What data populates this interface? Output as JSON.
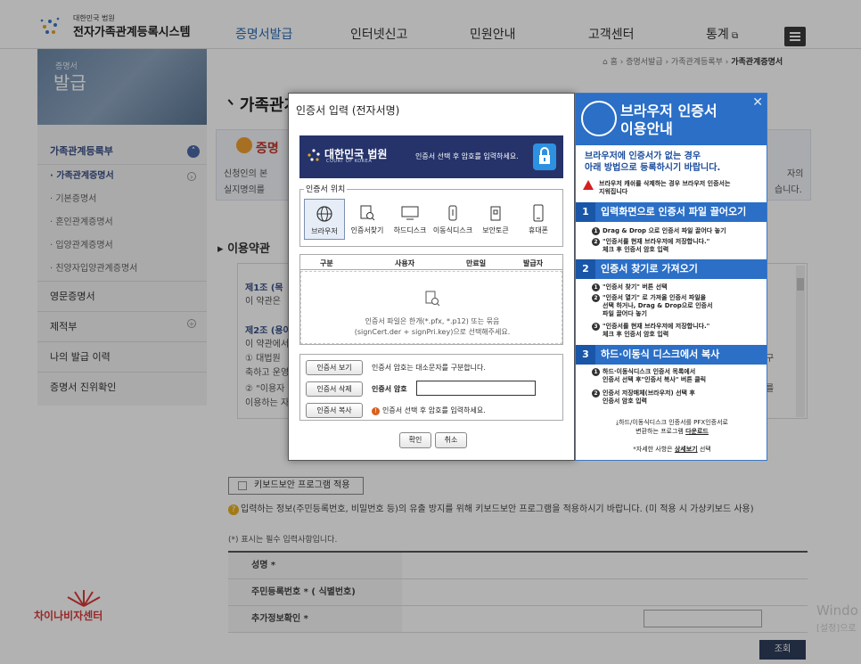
{
  "header": {
    "logo_small": "대한민국 법원",
    "logo_title": "전자가족관계등록시스템",
    "nav": [
      "증명서발급",
      "인터넷신고",
      "민원안내",
      "고객센터",
      "통계"
    ]
  },
  "sidebar": {
    "small": "증명서",
    "big": "발급",
    "items": [
      {
        "label": "가족관계등록부",
        "type": "head"
      },
      {
        "label": "· 가족관계증명서",
        "type": "sub-on"
      },
      {
        "label": "· 기본증명서",
        "type": "sub"
      },
      {
        "label": "· 혼인관계증명서",
        "type": "sub"
      },
      {
        "label": "· 입양관계증명서",
        "type": "sub"
      },
      {
        "label": "· 친양자입양관계증명서",
        "type": "sub"
      },
      {
        "label": "영문증명서",
        "type": "lvl"
      },
      {
        "label": "제적부",
        "type": "lvl"
      },
      {
        "label": "나의 발급 이력",
        "type": "lvl"
      },
      {
        "label": "증명서 진위확인",
        "type": "lvl"
      }
    ]
  },
  "breadcrumb": {
    "home": "홈",
    "path": "› 증명서발급 › 가족관계등록부 ›",
    "current": "가족관계증명서"
  },
  "page_title": "가족관계증명서",
  "notice": {
    "title": "증명",
    "line1": "신청인의 본",
    "line2": "실지명의를",
    "right1": "자의",
    "right2": "습니다."
  },
  "section_title": "이용약관",
  "terms": {
    "lines": [
      {
        "t": "제1조 (목",
        "hd": true
      },
      {
        "t": "이 약관은",
        "hd": false
      },
      {
        "t": "제2조 (용어",
        "hd": true
      },
      {
        "t": "이 약관에서",
        "hd": false
      },
      {
        "t": "① 대법원",
        "hd": false
      },
      {
        "t": "축하고 운영",
        "hd": false
      },
      {
        "t": "② \"이용자",
        "hd": false
      },
      {
        "t": "이용하는 자",
        "hd": false
      }
    ],
    "right": [
      "구",
      "를"
    ]
  },
  "keyboard_label": "키보드보안 프로그램 적용",
  "keyboard_hint": "입력하는 정보(주민등록번호, 비밀번호 등)의 유출 방지를 위해 키보드보안 프로그램을 적용하시기 바랍니다. (미 적용 시 가상키보드 사용)",
  "required_note": "(*) 표시는 필수 입력사항입니다.",
  "form": {
    "name_label": "성명 *",
    "rrn_label": "주민등록번호 * (  식별번호)",
    "extra_label": "추가정보확인 *",
    "submit": "조회"
  },
  "watermark": "차이나비자센터",
  "windows_activation": {
    "l1": "Windo",
    "l2": "[설정]으로"
  },
  "cert_dialog": {
    "title": "인증서 입력 (전자서명)",
    "banner_org": "대한민국 법원",
    "banner_org_en": "COURT OF KOREA",
    "banner_msg": "인증서 선택 후 암호를 입력하세요.",
    "location_legend": "인증서 위치",
    "locations": [
      "브라우저",
      "인증서찾기",
      "하드디스크",
      "이동식디스크",
      "보안토큰",
      "휴대폰"
    ],
    "columns": [
      "구분",
      "사용자",
      "만료일",
      "발급자"
    ],
    "drop_line1": "인증서 파일은 한개(*.pfx, *.p12) 또는 묶음",
    "drop_line2": "(signCert.der + signPri.key)으로 선택해주세요.",
    "btn_view": "인증서 보기",
    "btn_delete": "인증서 삭제",
    "btn_copy": "인증서 복사",
    "case_note": "인증서 암호는 대소문자를 구분합니다.",
    "pw_label": "인증서 암호",
    "select_note": "인증서 선택 후 암호를 입력하세요.",
    "ok": "확인",
    "cancel": "취소"
  },
  "guide": {
    "title1": "브라우저 인증서",
    "title2": "이용안내",
    "sub1": "브라우저에 인증서가 없는 경우",
    "sub2": "아래 방법으로 등록하시기 바랍니다.",
    "warn1": "브라우저 캐쉬를 삭제하는 경우 브라우저 인증서는",
    "warn2": "지워집니다",
    "step1": "입력화면으로 인증서 파일 끌어오기",
    "s1a": "Drag & Drop 으로 인증서 파일 끌어다 놓기",
    "s1b1": "\"인증서를 현재 브라우저에 저장합니다.\"",
    "s1b2": "체크 후 인증서 암호 입력",
    "step2": "인증서 찾기로 가져오기",
    "s2a": "\"인증서 찾기\" 버튼 선택",
    "s2b1": "\"인증서 열기\" 로 가져올 인증서 파일을",
    "s2b2": "선택 하거나, Drag & Drop으로 인증서",
    "s2b3": "파일 끌어다 놓기",
    "s2c1": "\"인증서를 현재 브라우저에 저장합니다.\"",
    "s2c2": "체크 후 인증서 암호 입력",
    "step3": "하드·이동식 디스크에서 복사",
    "s3a1": "하드·이동식디스크 인증서 목록에서",
    "s3a2": "인증서 선택 후\"인증서 복사\" 버튼 클릭",
    "s3b1": "인증서 저장매체(브라우저) 선택 후",
    "s3b2": "인증서 암호 입력",
    "dl1": "하드/이동식디스크 인증서를 PFX인증서로",
    "dl2": "변환하는 프로그램",
    "dl_link": "다운로드",
    "more": "*자세한 사항은",
    "more_link": "상세보기",
    "more_tail": "선택"
  }
}
